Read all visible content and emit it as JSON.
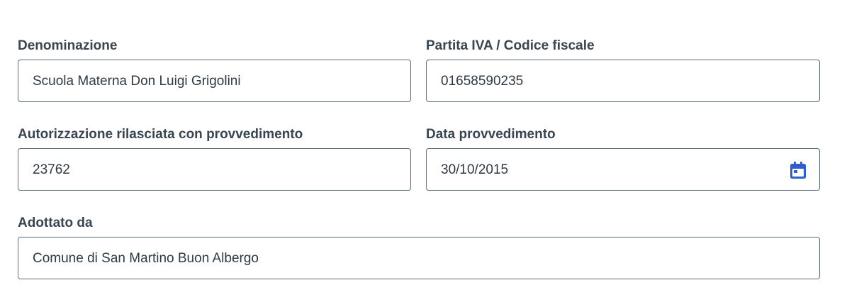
{
  "form": {
    "denominazione": {
      "label": "Denominazione",
      "value": "Scuola Materna Don Luigi Grigolini"
    },
    "partita_iva": {
      "label": "Partita IVA / Codice fiscale",
      "value": "01658590235"
    },
    "autorizzazione": {
      "label": "Autorizzazione rilasciata con provvedimento",
      "value": "23762"
    },
    "data_provvedimento": {
      "label": "Data provvedimento",
      "value": "30/10/2015",
      "icon": "calendar-icon"
    },
    "adottato_da": {
      "label": "Adottato da",
      "value": "Comune di San Martino Buon Albergo"
    }
  },
  "colors": {
    "label": "#3a4552",
    "border": "#5c6f82",
    "accent": "#2e5fcc"
  }
}
